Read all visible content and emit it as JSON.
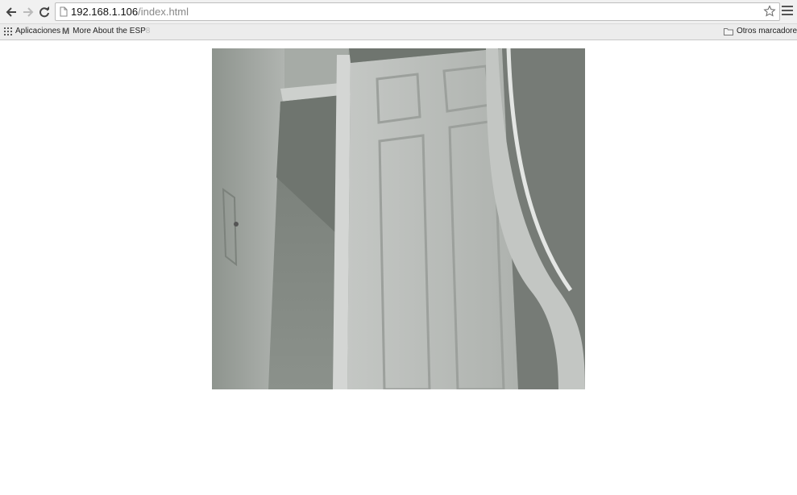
{
  "browser": {
    "address_bar": {
      "host": "192.168.1.106",
      "path": "/index.html"
    },
    "icons": {
      "back": "back-arrow-icon",
      "forward": "forward-arrow-icon",
      "reload": "reload-icon",
      "page": "page-icon",
      "bookmark_star": "star-icon",
      "menu": "menu-icon"
    }
  },
  "bookmarks_bar": {
    "apps_label": "Aplicaciones",
    "items": [
      {
        "label_main": "More About the ESP",
        "label_faded": "8",
        "icon": "gmail-icon"
      }
    ],
    "other_bookmarks_label": "Otros marcadores"
  },
  "page": {
    "image_description_icon": "camera-stream-image",
    "colors": {
      "background": "#ffffff"
    }
  }
}
